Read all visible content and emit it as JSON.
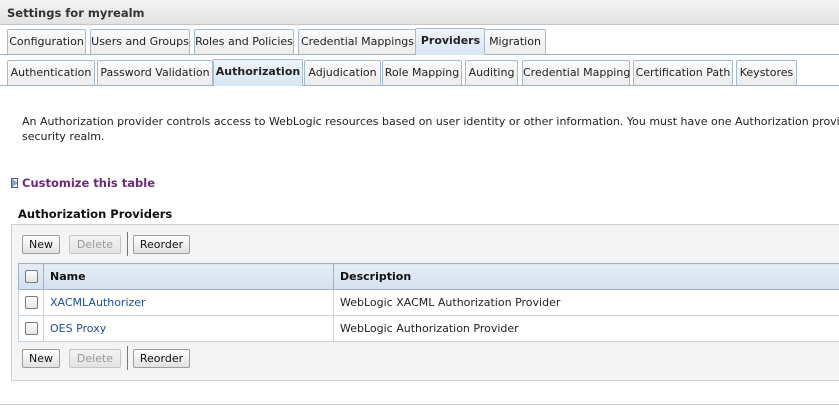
{
  "window": {
    "title": "Settings for myrealm"
  },
  "tabs_primary": [
    {
      "label": "Configuration",
      "active": false
    },
    {
      "label": "Users and Groups",
      "active": false
    },
    {
      "label": "Roles and Policies",
      "active": false
    },
    {
      "label": "Credential Mappings",
      "active": false
    },
    {
      "label": "Providers",
      "active": true
    },
    {
      "label": "Migration",
      "active": false
    }
  ],
  "tabs_secondary": [
    {
      "label": "Authentication",
      "active": false
    },
    {
      "label": "Password Validation",
      "active": false
    },
    {
      "label": "Authorization",
      "active": true
    },
    {
      "label": "Adjudication",
      "active": false
    },
    {
      "label": "Role Mapping",
      "active": false
    },
    {
      "label": "Auditing",
      "active": false
    },
    {
      "label": "Credential Mapping",
      "active": false
    },
    {
      "label": "Certification Path",
      "active": false
    },
    {
      "label": "Keystores",
      "active": false
    }
  ],
  "description": {
    "line1": "An Authorization provider controls access to WebLogic resources based on user identity or other information. You must have one Authorization provider in a security realm,",
    "line2": "security realm."
  },
  "customize": {
    "label": "Customize this table"
  },
  "table": {
    "title": "Authorization Providers",
    "buttons": {
      "new": "New",
      "delete": "Delete",
      "reorder": "Reorder"
    },
    "headers": {
      "name": "Name",
      "description": "Description"
    },
    "rows": [
      {
        "name": "XACMLAuthorizer",
        "description": "WebLogic XACML Authorization Provider"
      },
      {
        "name": "OES Proxy",
        "description": "WebLogic Authorization Provider"
      }
    ]
  },
  "colors": {
    "link": "#1a4d99",
    "customize": "#6b2a7a",
    "tab_border": "#a9b9cc"
  }
}
